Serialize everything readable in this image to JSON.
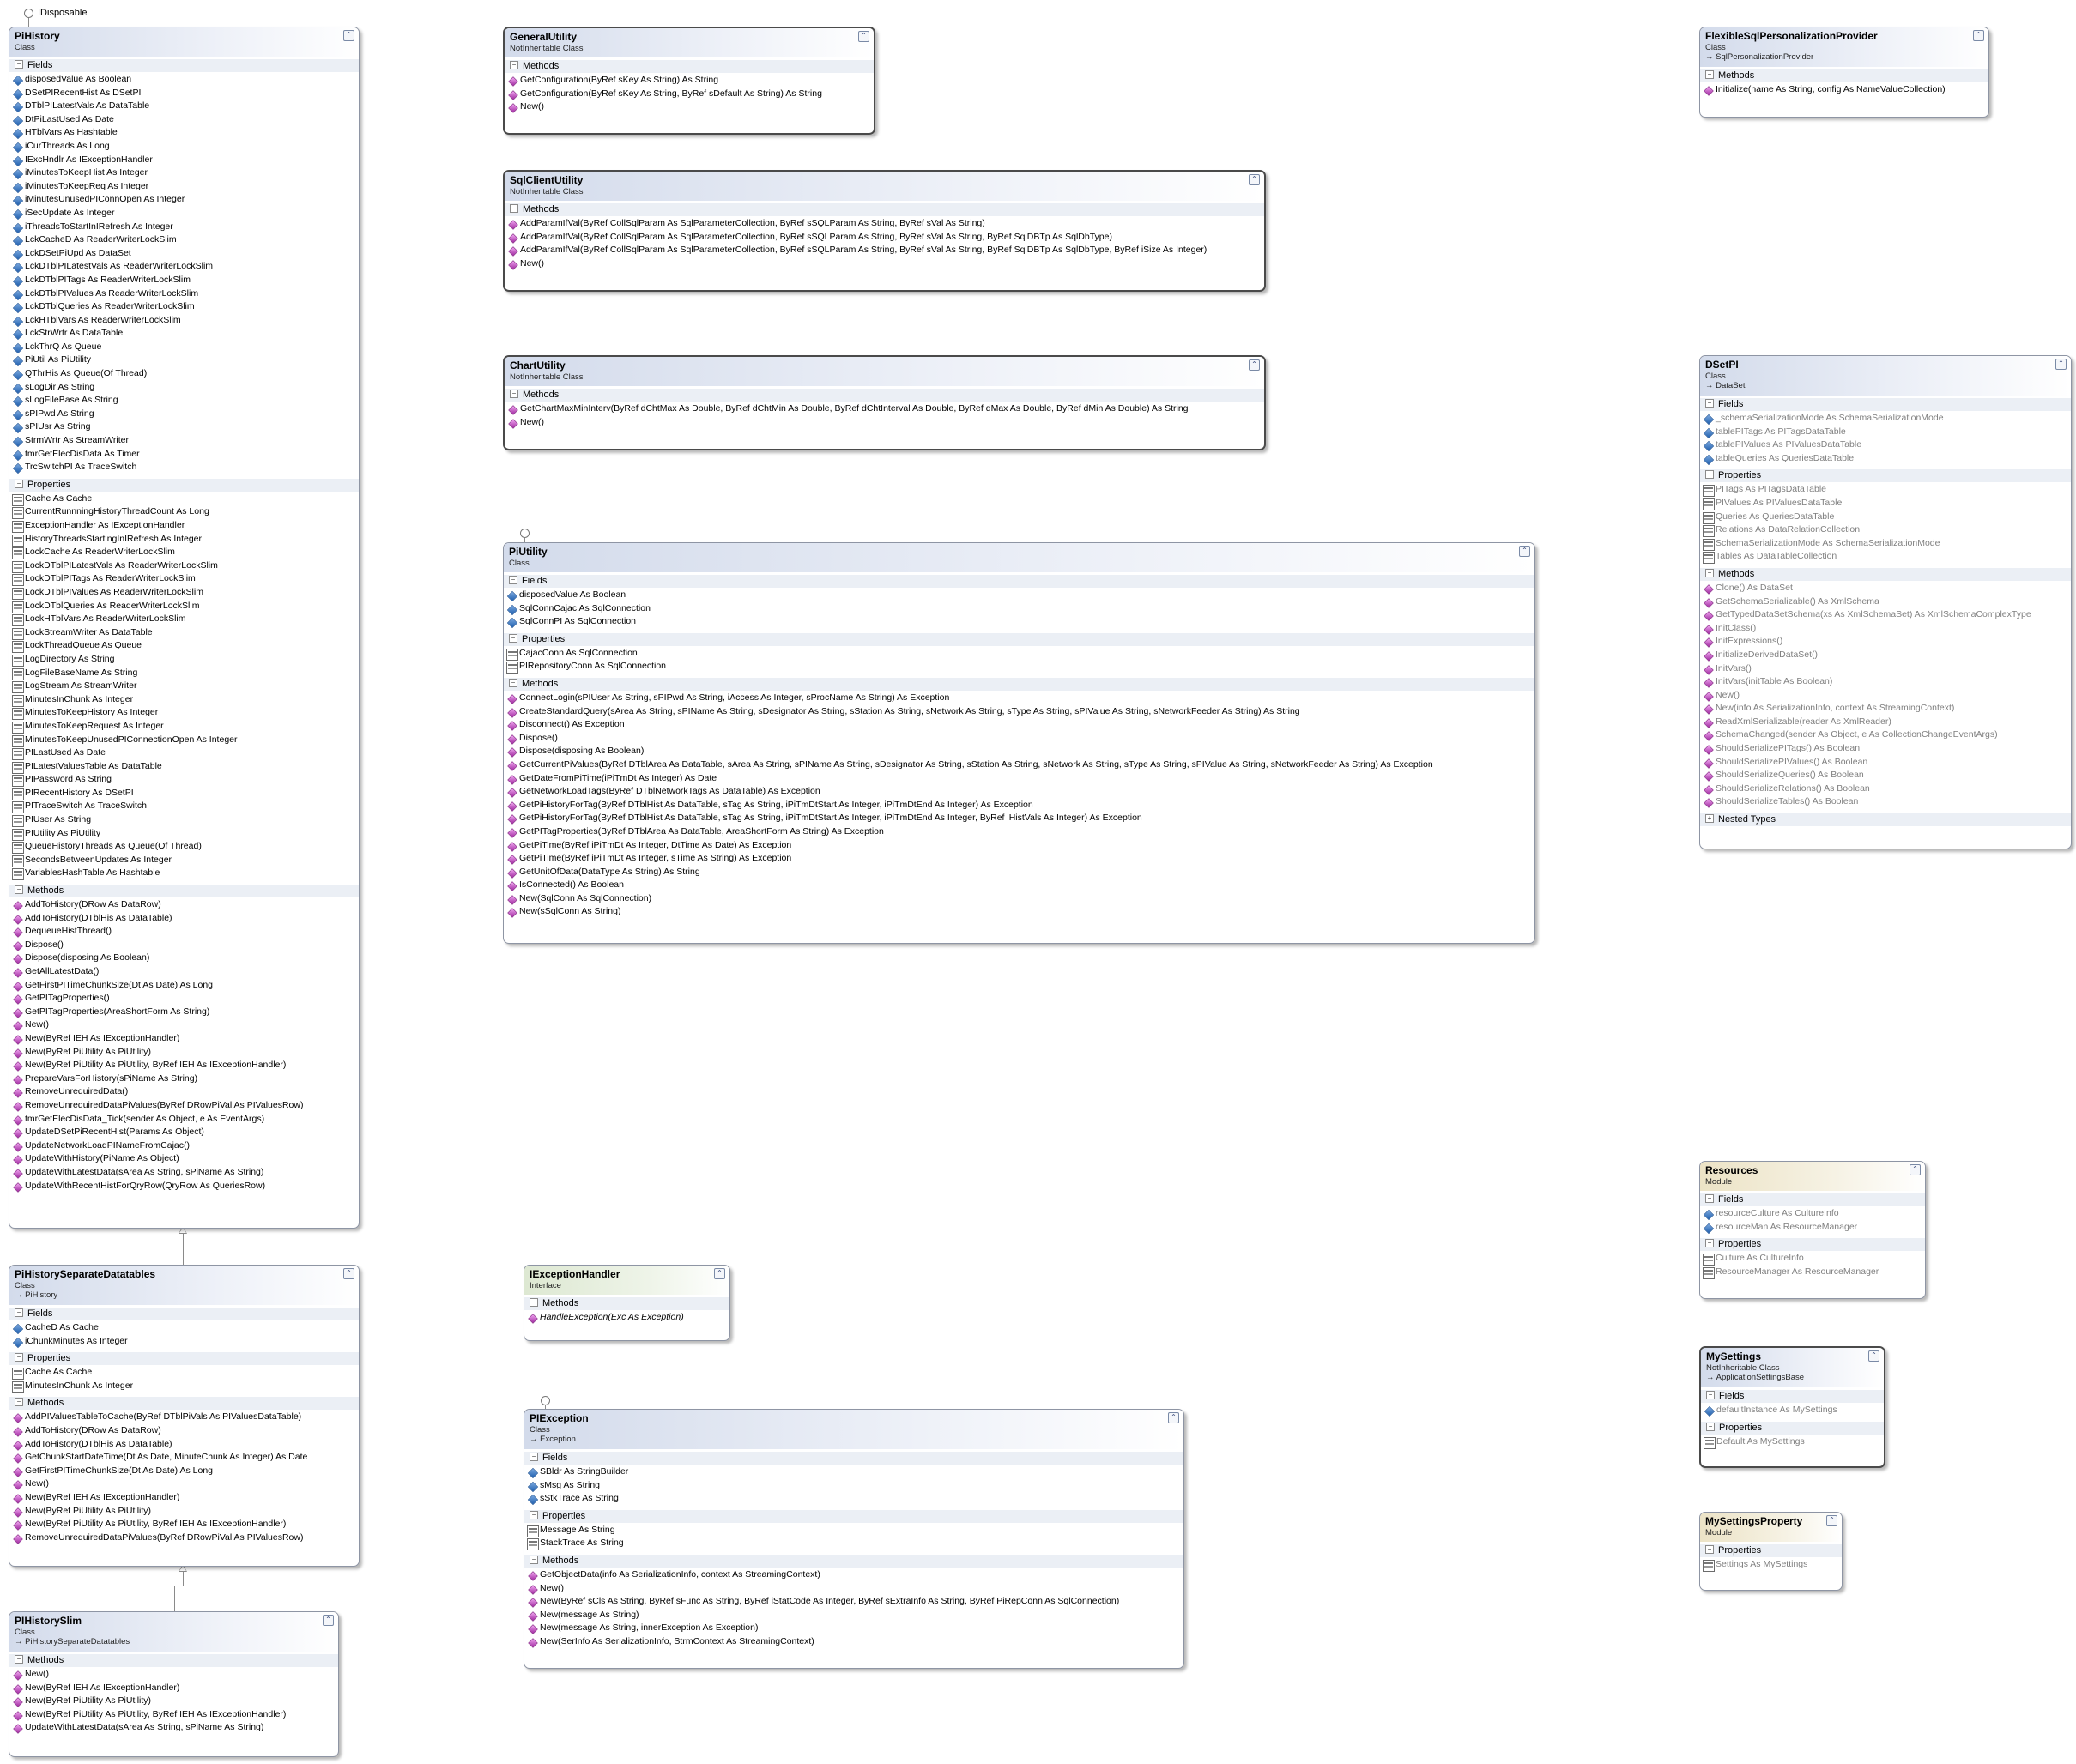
{
  "interface_label": "IDisposable",
  "boxes": [
    {
      "id": "pihistory",
      "name": "PiHistory",
      "kind": "Class",
      "base": "",
      "style": "class",
      "sections": [
        {
          "title": "Fields",
          "icon": "field",
          "items": [
            "disposedValue As Boolean",
            "DSetPIRecentHist As DSetPI",
            "DTblPILatestVals As DataTable",
            "DtPiLastUsed As Date",
            "HTblVars As Hashtable",
            "iCurThreads As Long",
            "IExcHndlr As IExceptionHandler",
            "iMinutesToKeepHist As Integer",
            "iMinutesToKeepReq As Integer",
            "iMinutesUnusedPIConnOpen As Integer",
            "iSecUpdate As Integer",
            "iThreadsToStartInIRefresh As Integer",
            "LckCacheD As ReaderWriterLockSlim",
            "LckDSetPiUpd As DataSet",
            "LckDTblPILatestVals As ReaderWriterLockSlim",
            "LckDTblPITags As ReaderWriterLockSlim",
            "LckDTblPIValues As ReaderWriterLockSlim",
            "LckDTblQueries As ReaderWriterLockSlim",
            "LckHTblVars As ReaderWriterLockSlim",
            "LckStrWrtr As DataTable",
            "LckThrQ As Queue",
            "PiUtil As PiUtility",
            "QThrHis As Queue(Of Thread)",
            "sLogDir As String",
            "sLogFileBase As String",
            "sPIPwd As String",
            "sPIUsr As String",
            "StrmWrtr As StreamWriter",
            "tmrGetElecDisData As Timer",
            "TrcSwitchPI As TraceSwitch"
          ]
        },
        {
          "title": "Properties",
          "icon": "prop",
          "items": [
            "Cache As Cache",
            "CurrentRunnningHistoryThreadCount As Long",
            "ExceptionHandler As IExceptionHandler",
            "HistoryThreadsStartingInIRefresh As Integer",
            "LockCache As ReaderWriterLockSlim",
            "LockDTblPILatestVals As ReaderWriterLockSlim",
            "LockDTblPITags As ReaderWriterLockSlim",
            "LockDTblPIValues As ReaderWriterLockSlim",
            "LockDTblQueries As ReaderWriterLockSlim",
            "LockHTblVars As ReaderWriterLockSlim",
            "LockStreamWriter As DataTable",
            "LockThreadQueue As Queue",
            "LogDirectory As String",
            "LogFileBaseName As String",
            "LogStream As StreamWriter",
            "MinutesInChunk As Integer",
            "MinutesToKeepHistory As Integer",
            "MinutesToKeepRequest As Integer",
            "MinutesToKeepUnusedPIConnectionOpen As Integer",
            "PILastUsed As Date",
            "PILatestValuesTable As DataTable",
            "PIPassword As String",
            "PIRecentHistory As DSetPI",
            "PITraceSwitch As TraceSwitch",
            "PIUser As String",
            "PIUtility As PiUtility",
            "QueueHistoryThreads As Queue(Of Thread)",
            "SecondsBetweenUpdates As Integer",
            "VariablesHashTable As Hashtable"
          ]
        },
        {
          "title": "Methods",
          "icon": "method",
          "items": [
            "AddToHistory(DRow As DataRow)",
            "AddToHistory(DTblHis As DataTable)",
            "DequeueHistThread()",
            "Dispose()",
            "Dispose(disposing As Boolean)",
            "GetAllLatestData()",
            "GetFirstPITimeChunkSize(Dt As Date) As Long",
            "GetPITagProperties()",
            "GetPITagProperties(AreaShortForm As String)",
            "New()",
            "New(ByRef IEH As IExceptionHandler)",
            "New(ByRef PiUtility As PiUtility)",
            "New(ByRef PiUtility As PiUtility, ByRef IEH As IExceptionHandler)",
            "PrepareVarsForHistory(sPiName As String)",
            "RemoveUnrequiredData()",
            "RemoveUnrequiredDataPiValues(ByRef DRowPiVal As PIValuesRow)",
            "tmrGetElecDisData_Tick(sender As Object, e As EventArgs)",
            "UpdateDSetPiRecentHist(Params As Object)",
            "UpdateNetworkLoadPINameFromCajac()",
            "UpdateWithHistory(PiName As Object)",
            "UpdateWithLatestData(sArea As String, sPiName As String)",
            "UpdateWithRecentHistForQryRow(QryRow As QueriesRow)"
          ]
        }
      ]
    },
    {
      "id": "general",
      "name": "GeneralUtility",
      "kind": "NotInheritable Class",
      "base": "",
      "style": "class",
      "sections": [
        {
          "title": "Methods",
          "icon": "method",
          "items": [
            "GetConfiguration(ByRef sKey As String) As String",
            "GetConfiguration(ByRef sKey As String, ByRef sDefault As String) As String",
            "New()"
          ]
        }
      ]
    },
    {
      "id": "sqlclient",
      "name": "SqlClientUtility",
      "kind": "NotInheritable Class",
      "base": "",
      "style": "class",
      "sections": [
        {
          "title": "Methods",
          "icon": "method",
          "items": [
            "AddParamIfVal(ByRef CollSqlParam As SqlParameterCollection, ByRef sSQLParam As String, ByRef sVal As String)",
            "AddParamIfVal(ByRef CollSqlParam As SqlParameterCollection, ByRef sSQLParam As String, ByRef sVal As String, ByRef SqlDBTp As SqlDbType)",
            "AddParamIfVal(ByRef CollSqlParam As SqlParameterCollection, ByRef sSQLParam As String, ByRef sVal As String, ByRef SqlDBTp As SqlDbType, ByRef iSize As Integer)",
            "New()"
          ]
        }
      ]
    },
    {
      "id": "chart",
      "name": "ChartUtility",
      "kind": "NotInheritable Class",
      "base": "",
      "style": "class",
      "sections": [
        {
          "title": "Methods",
          "icon": "method",
          "items": [
            "GetChartMaxMinInterv(ByRef dChtMax As Double, ByRef dChtMin As Double, ByRef dChtInterval As Double, ByRef dMax As Double, ByRef dMin As Double) As String",
            "New()"
          ]
        }
      ]
    },
    {
      "id": "piutility",
      "name": "PiUtility",
      "kind": "Class",
      "base": "",
      "style": "class",
      "sections": [
        {
          "title": "Fields",
          "icon": "field",
          "items": [
            "disposedValue As Boolean",
            "SqlConnCajac As SqlConnection",
            "SqlConnPI As SqlConnection"
          ]
        },
        {
          "title": "Properties",
          "icon": "prop",
          "items": [
            "CajacConn As SqlConnection",
            "PIRepositoryConn As SqlConnection"
          ]
        },
        {
          "title": "Methods",
          "icon": "method",
          "items": [
            "ConnectLogin(sPIUser As String, sPIPwd As String, iAccess As Integer, sProcName As String) As Exception",
            "CreateStandardQuery(sArea As String, sPIName As String, sDesignator As String, sStation As String, sNetwork As String, sType As String, sPIValue As String, sNetworkFeeder As String) As String",
            "Disconnect() As Exception",
            "Dispose()",
            "Dispose(disposing As Boolean)",
            "GetCurrentPiValues(ByRef DTblArea As DataTable, sArea As String, sPIName As String, sDesignator As String, sStation As String, sNetwork As String, sType As String, sPIValue As String, sNetworkFeeder As String) As Exception",
            "GetDateFromPiTime(iPiTmDt As Integer) As Date",
            "GetNetworkLoadTags(ByRef DTblNetworkTags As DataTable) As Exception",
            "GetPiHistoryForTag(ByRef DTblHist As DataTable, sTag As String, iPiTmDtStart As Integer, iPiTmDtEnd As Integer) As Exception",
            "GetPiHistoryForTag(ByRef DTblHist As DataTable, sTag As String, iPiTmDtStart As Integer, iPiTmDtEnd As Integer, ByRef iHistVals As Integer) As Exception",
            "GetPITagProperties(ByRef DTblArea As DataTable, AreaShortForm As String) As Exception",
            "GetPiTime(ByRef iPiTmDt As Integer, DtTime As Date) As Exception",
            "GetPiTime(ByRef iPiTmDt As Integer, sTime As String) As Exception",
            "GetUnitOfData(DataType As String) As String",
            "IsConnected() As Boolean",
            "New(SqlConn As SqlConnection)",
            "New(sSqlConn As String)"
          ]
        }
      ]
    },
    {
      "id": "flex",
      "name": "FlexibleSqlPersonalizationProvider",
      "kind": "Class",
      "base": "SqlPersonalizationProvider",
      "style": "class",
      "sections": [
        {
          "title": "Methods",
          "icon": "method",
          "items": [
            "Initialize(name As String, config As NameValueCollection)"
          ]
        }
      ]
    },
    {
      "id": "dsetpi",
      "name": "DSetPI",
      "kind": "Class",
      "base": "DataSet",
      "style": "class",
      "dim": true,
      "sections": [
        {
          "title": "Fields",
          "icon": "field",
          "items": [
            "_schemaSerializationMode As SchemaSerializationMode",
            "tablePITags As PITagsDataTable",
            "tablePIValues As PIValuesDataTable",
            "tableQueries As QueriesDataTable"
          ]
        },
        {
          "title": "Properties",
          "icon": "prop",
          "items": [
            "PITags As PITagsDataTable",
            "PIValues As PIValuesDataTable",
            "Queries As QueriesDataTable",
            "Relations As DataRelationCollection",
            "SchemaSerializationMode As SchemaSerializationMode",
            "Tables As DataTableCollection"
          ]
        },
        {
          "title": "Methods",
          "icon": "method",
          "items": [
            "Clone() As DataSet",
            "GetSchemaSerializable() As XmlSchema",
            "GetTypedDataSetSchema(xs As XmlSchemaSet) As XmlSchemaComplexType",
            "InitClass()",
            "InitExpressions()",
            "InitializeDerivedDataSet()",
            "InitVars()",
            "InitVars(initTable As Boolean)",
            "New()",
            "New(info As SerializationInfo, context As StreamingContext)",
            "ReadXmlSerializable(reader As XmlReader)",
            "SchemaChanged(sender As Object, e As CollectionChangeEventArgs)",
            "ShouldSerializePITags() As Boolean",
            "ShouldSerializePIValues() As Boolean",
            "ShouldSerializeQueries() As Boolean",
            "ShouldSerializeRelations() As Boolean",
            "ShouldSerializeTables() As Boolean"
          ]
        },
        {
          "title": "Nested Types",
          "icon": "none",
          "collapsed": true,
          "items": []
        }
      ]
    },
    {
      "id": "pihsd",
      "name": "PiHistorySeparateDatatables",
      "kind": "Class",
      "base": "PiHistory",
      "style": "class",
      "sections": [
        {
          "title": "Fields",
          "icon": "field",
          "items": [
            "CacheD As Cache",
            "iChunkMinutes As Integer"
          ]
        },
        {
          "title": "Properties",
          "icon": "prop",
          "items": [
            "Cache As Cache",
            "MinutesInChunk As Integer"
          ]
        },
        {
          "title": "Methods",
          "icon": "method",
          "items": [
            "AddPIValuesTableToCache(ByRef DTblPiVals As PIValuesDataTable)",
            "AddToHistory(DRow As DataRow)",
            "AddToHistory(DTblHis As DataTable)",
            "GetChunkStartDateTime(Dt As Date, MinuteChunk As Integer) As Date",
            "GetFirstPITimeChunkSize(Dt As Date) As Long",
            "New()",
            "New(ByRef IEH As IExceptionHandler)",
            "New(ByRef PiUtility As PiUtility)",
            "New(ByRef PiUtility As PiUtility, ByRef IEH As IExceptionHandler)",
            "RemoveUnrequiredDataPiValues(ByRef DRowPiVal As PIValuesRow)"
          ]
        }
      ]
    },
    {
      "id": "iexc",
      "name": "IExceptionHandler",
      "kind": "Interface",
      "base": "",
      "style": "iface",
      "sections": [
        {
          "title": "Methods",
          "icon": "method",
          "italic": true,
          "items": [
            "HandleException(Exc As Exception)"
          ]
        }
      ]
    },
    {
      "id": "resources",
      "name": "Resources",
      "kind": "Module",
      "base": "",
      "style": "module",
      "dim": true,
      "sections": [
        {
          "title": "Fields",
          "icon": "field",
          "items": [
            "resourceCulture As CultureInfo",
            "resourceMan As ResourceManager"
          ]
        },
        {
          "title": "Properties",
          "icon": "prop",
          "items": [
            "Culture As CultureInfo",
            "ResourceManager As ResourceManager"
          ]
        }
      ]
    },
    {
      "id": "mysettings",
      "name": "MySettings",
      "kind": "NotInheritable Class",
      "base": "ApplicationSettingsBase",
      "style": "class",
      "dim": true,
      "sections": [
        {
          "title": "Fields",
          "icon": "field",
          "items": [
            "defaultInstance As MySettings"
          ]
        },
        {
          "title": "Properties",
          "icon": "prop",
          "items": [
            "Default As MySettings"
          ]
        }
      ]
    },
    {
      "id": "mysettingsprop",
      "name": "MySettingsProperty",
      "kind": "Module",
      "base": "",
      "style": "module",
      "dim": true,
      "sections": [
        {
          "title": "Properties",
          "icon": "prop",
          "items": [
            "Settings As MySettings"
          ]
        }
      ]
    },
    {
      "id": "piexception",
      "name": "PIException",
      "kind": "Class",
      "base": "Exception",
      "style": "class",
      "sections": [
        {
          "title": "Fields",
          "icon": "field",
          "items": [
            "SBldr As StringBuilder",
            "sMsg As String",
            "sStkTrace As String"
          ]
        },
        {
          "title": "Properties",
          "icon": "prop",
          "items": [
            "Message As String",
            "StackTrace As String"
          ]
        },
        {
          "title": "Methods",
          "icon": "method",
          "items": [
            "GetObjectData(info As SerializationInfo, context As StreamingContext)",
            "New()",
            "New(ByRef sCls As String, ByRef sFunc As String, ByRef iStatCode As Integer, ByRef sExtraInfo As String, ByRef PiRepConn As SqlConnection)",
            "New(message As String)",
            "New(message As String, innerException As Exception)",
            "New(SerInfo As SerializationInfo, StrmContext As StreamingContext)"
          ]
        }
      ]
    },
    {
      "id": "pihslim",
      "name": "PIHistorySlim",
      "kind": "Class",
      "base": "PiHistorySeparateDatatables",
      "style": "class",
      "sections": [
        {
          "title": "Methods",
          "icon": "method",
          "items": [
            "New()",
            "New(ByRef IEH As IExceptionHandler)",
            "New(ByRef PiUtility As PiUtility)",
            "New(ByRef PiUtility As PiUtility, ByRef IEH As IExceptionHandler)",
            "UpdateWithLatestData(sArea As String, sPiName As String)"
          ]
        }
      ]
    }
  ]
}
